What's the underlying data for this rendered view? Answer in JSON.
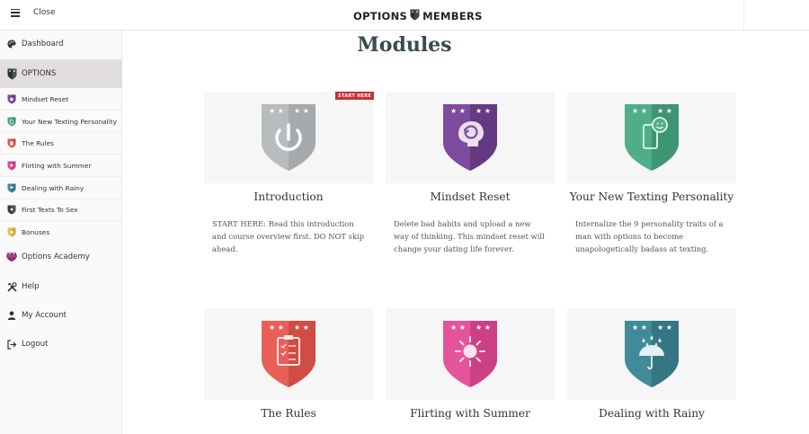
{
  "header": {
    "close_label": "Close",
    "brand_left": "OPTIONS",
    "brand_right": "MEMBERS"
  },
  "sidebar": {
    "items": [
      {
        "label": "Dashboard",
        "icon": "palette-icon"
      },
      {
        "label": "OPTIONS",
        "icon": "options-shield-icon",
        "active": true
      },
      {
        "label": "Mindset Reset",
        "icon": "purple-shield-icon",
        "color": "#7b4a9b"
      },
      {
        "label": "Your New Texting Personality",
        "icon": "green-shield-icon",
        "color": "#4aa883"
      },
      {
        "label": "The Rules",
        "icon": "red-shield-icon",
        "color": "#e05a55"
      },
      {
        "label": "Flirting with Summer",
        "icon": "pink-shield-icon",
        "color": "#e04c95"
      },
      {
        "label": "Dealing with Rainy",
        "icon": "teal-shield-icon",
        "color": "#3f8b97"
      },
      {
        "label": "First Texts To Sex",
        "icon": "dark-shield-icon",
        "color": "#333a40"
      },
      {
        "label": "Bonuses",
        "icon": "yellow-shield-icon",
        "color": "#e0c050"
      },
      {
        "label": "Options Academy",
        "icon": "academy-icon"
      },
      {
        "label": "Help",
        "icon": "tools-icon"
      },
      {
        "label": "My Account",
        "icon": "user-icon"
      },
      {
        "label": "Logout",
        "icon": "logout-icon"
      }
    ]
  },
  "main": {
    "title": "Modules",
    "start_badge": "START HERE",
    "cards": [
      {
        "title": "Introduction",
        "desc": [
          "START HERE: Read this introduction",
          "and course overview first. DO NOT skip",
          "ahead."
        ],
        "color": "#b9bcbe",
        "dark": "#a4a8aa",
        "icon": "power-icon"
      },
      {
        "title": "Mindset Reset",
        "desc": [
          "Delete bad habits and upload a new",
          "way of thinking. This mindset reset will",
          "change your dating life forever."
        ],
        "color": "#7d4b9d",
        "dark": "#653a82",
        "icon": "brain-refresh-icon"
      },
      {
        "title": "Your New Texting Personality",
        "desc": [
          "Internalize the 9 personality traits of a",
          "man with options to become",
          "unapologetically badass at texting."
        ],
        "color": "#4fae89",
        "dark": "#3e9573",
        "icon": "smiley-phone-icon"
      },
      {
        "title": "The Rules",
        "desc": [],
        "color": "#e85f57",
        "dark": "#d04c45",
        "icon": "clipboard-icon"
      },
      {
        "title": "Flirting with Summer",
        "desc": [],
        "color": "#e4549b",
        "dark": "#cc4185",
        "icon": "sun-icon"
      },
      {
        "title": "Dealing with Rainy",
        "desc": [],
        "color": "#418b98",
        "dark": "#347682",
        "icon": "umbrella-icon"
      }
    ]
  }
}
